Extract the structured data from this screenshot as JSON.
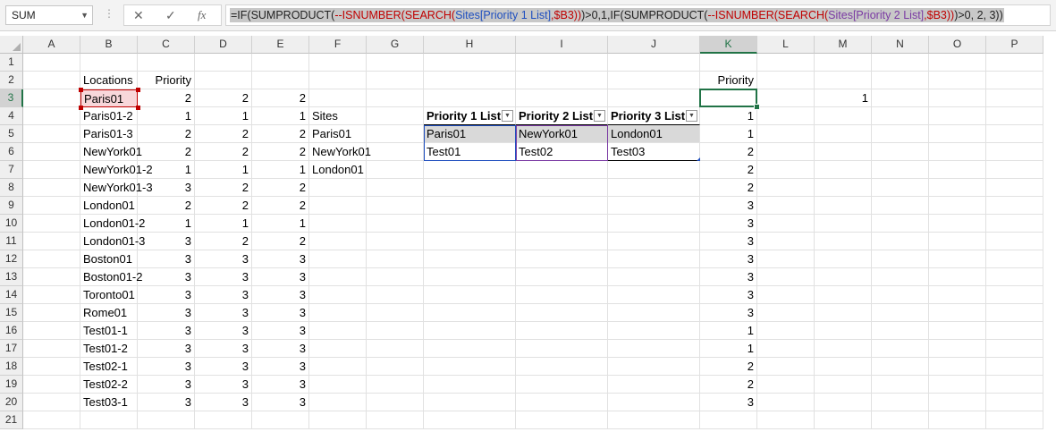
{
  "name_box": {
    "value": "SUM"
  },
  "formula_bar": {
    "tokens": [
      {
        "t": "=IF(SUMPRODUCT(",
        "c": "b"
      },
      {
        "t": "--ISNUMBER(SEARCH(",
        "c": "r"
      },
      {
        "t": "Sites[Priority 1 List]",
        "c": "bl"
      },
      {
        "t": ",",
        "c": "r"
      },
      {
        "t": "$B3",
        "c": "r"
      },
      {
        "t": "))",
        "c": "r"
      },
      {
        "t": ")>0,1,IF(SUMPRODUCT(",
        "c": "b"
      },
      {
        "t": "--ISNUMBER(SEARCH(",
        "c": "r"
      },
      {
        "t": "Sites[Priority 2 List]",
        "c": "p"
      },
      {
        "t": ",",
        "c": "r"
      },
      {
        "t": "$B3",
        "c": "r"
      },
      {
        "t": "))",
        "c": "r"
      },
      {
        "t": ")>0, 2, 3))",
        "c": "b"
      }
    ],
    "buttons": {
      "cancel": "✕",
      "enter": "✓",
      "fx": "fx"
    }
  },
  "columns": [
    "A",
    "B",
    "C",
    "D",
    "E",
    "F",
    "G",
    "H",
    "I",
    "J",
    "K",
    "L",
    "M",
    "N",
    "O",
    "P"
  ],
  "rows": [
    "1",
    "2",
    "3",
    "4",
    "5",
    "6",
    "7",
    "8",
    "9",
    "10",
    "11",
    "12",
    "13",
    "14",
    "15",
    "16",
    "17",
    "18",
    "19",
    "20",
    "21"
  ],
  "active": {
    "col": "K",
    "row": "3"
  },
  "cells": {
    "B2": "Locations",
    "C2": "Priority",
    "K2": "Priority",
    "B3": "Paris01",
    "C3": "2",
    "D3": "2",
    "E3": "2",
    "M3": "1",
    "B4": "Paris01-2",
    "C4": "1",
    "D4": "1",
    "E4": "1",
    "F4": "Sites",
    "K4": "1",
    "B5": "Paris01-3",
    "C5": "2",
    "D5": "2",
    "E5": "2",
    "F5": "Paris01",
    "K5": "1",
    "B6": "NewYork01",
    "C6": "2",
    "D6": "2",
    "E6": "2",
    "F6": "NewYork01",
    "K6": "2",
    "B7": "NewYork01-2",
    "C7": "1",
    "D7": "1",
    "E7": "1",
    "F7": "London01",
    "K7": "2",
    "B8": "NewYork01-3",
    "C8": "3",
    "D8": "2",
    "E8": "2",
    "K8": "2",
    "B9": "London01",
    "C9": "2",
    "D9": "2",
    "E9": "2",
    "K9": "3",
    "B10": "London01-2",
    "C10": "1",
    "D10": "1",
    "E10": "1",
    "K10": "3",
    "B11": "London01-3",
    "C11": "3",
    "D11": "2",
    "E11": "2",
    "K11": "3",
    "B12": "Boston01",
    "C12": "3",
    "D12": "3",
    "E12": "3",
    "K12": "3",
    "B13": "Boston01-2",
    "C13": "3",
    "D13": "3",
    "E13": "3",
    "K13": "3",
    "B14": "Toronto01",
    "C14": "3",
    "D14": "3",
    "E14": "3",
    "K14": "3",
    "B15": "Rome01",
    "C15": "3",
    "D15": "3",
    "E15": "3",
    "K15": "3",
    "B16": "Test01-1",
    "C16": "3",
    "D16": "3",
    "E16": "3",
    "K16": "1",
    "B17": "Test01-2",
    "C17": "3",
    "D17": "3",
    "E17": "3",
    "K17": "1",
    "B18": "Test02-1",
    "C18": "3",
    "D18": "3",
    "E18": "3",
    "K18": "2",
    "B19": "Test02-2",
    "C19": "3",
    "D19": "3",
    "E19": "3",
    "K19": "2",
    "B20": "Test03-1",
    "C20": "3",
    "D20": "3",
    "E20": "3",
    "K20": "3"
  },
  "sites_table": {
    "headers": [
      "Priority 1 List",
      "Priority 2 List",
      "Priority 3 List"
    ],
    "rows": [
      [
        "Paris01",
        "NewYork01",
        "London01"
      ],
      [
        "Test01",
        "Test02",
        "Test03"
      ]
    ]
  },
  "colors": {
    "excel_green": "#217346",
    "ref1_blue": "#1f4fbf",
    "ref2_purple": "#7a3aa3",
    "ref_red": "#c00000",
    "ref_red_fill": "#f8d7da",
    "table_band": "#d9d9d9"
  }
}
